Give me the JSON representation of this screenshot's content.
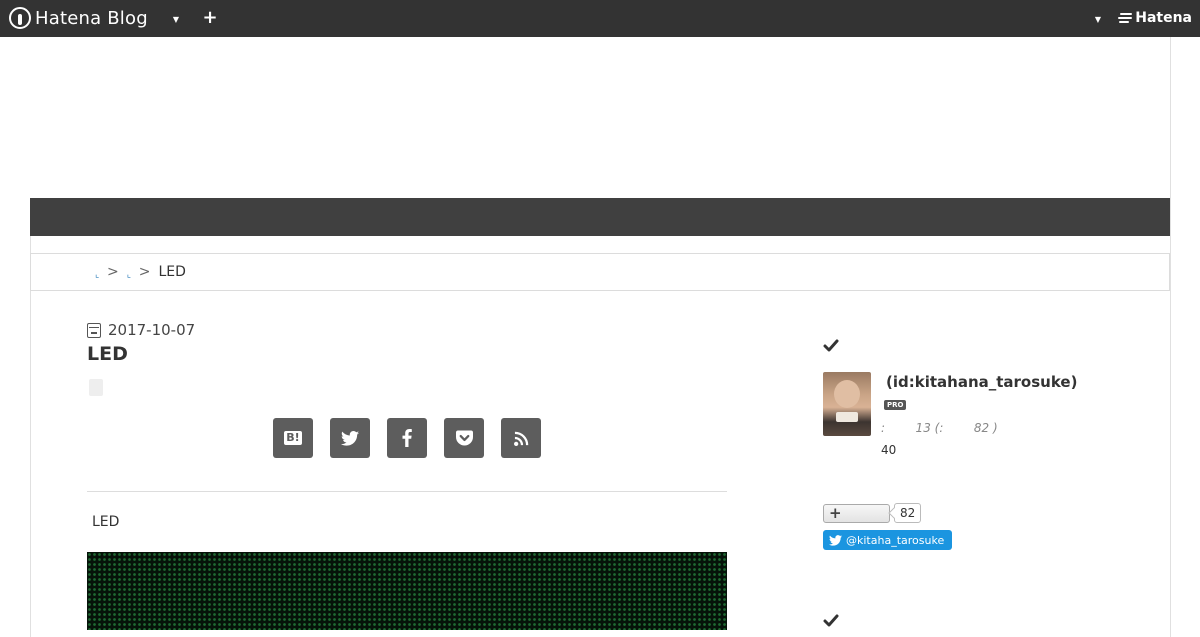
{
  "global_header": {
    "logo_text": "Hatena Blog",
    "brand_text": "Hatena",
    "icons": [
      "hatena-blog-logo-icon",
      "chevron-down-icon",
      "plus-icon",
      "hatena-mark-icon"
    ]
  },
  "breadcrumb": {
    "items": [
      "",
      ""
    ],
    "separator": ">",
    "current": "LED"
  },
  "entry": {
    "date": "2017-10-07",
    "title": "LED",
    "body_text": "LED",
    "share_buttons": [
      {
        "name": "hatena-bookmark",
        "label": "B!"
      },
      {
        "name": "twitter"
      },
      {
        "name": "facebook"
      },
      {
        "name": "pocket"
      },
      {
        "name": "rss"
      }
    ]
  },
  "sidebar": {
    "profile": {
      "id_text": "(id:kitahana_tarosuke)",
      "badge": "PRO",
      "stats": ":        13 (:        82 )",
      "count": "40"
    },
    "follow": {
      "count": "82"
    },
    "twitter": {
      "handle": "@kitaha_tarosuke"
    }
  },
  "colors": {
    "header_bg": "#333333",
    "dark_bar": "#404040",
    "share_button_bg": "#5d5d5d",
    "twitter_blue": "#1b95e0"
  }
}
